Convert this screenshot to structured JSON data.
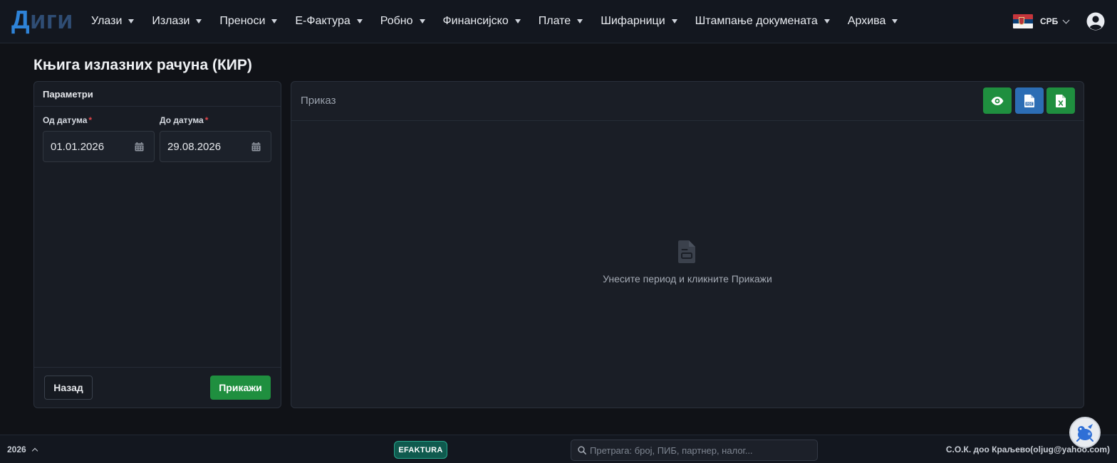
{
  "app": {
    "logo_part1": "Д",
    "logo_part2": "иги"
  },
  "nav": {
    "items": [
      {
        "label": "Улази"
      },
      {
        "label": "Излази"
      },
      {
        "label": "Преноси"
      },
      {
        "label": "Е-Фактура"
      },
      {
        "label": "Робно"
      },
      {
        "label": "Финансијско"
      },
      {
        "label": "Плате"
      },
      {
        "label": "Шифарници"
      },
      {
        "label": "Штампање докумената"
      },
      {
        "label": "Архива"
      }
    ],
    "language": "СРБ",
    "icons": {
      "dropdown": "caret-down-icon",
      "flag": "serbia-flag-icon",
      "user": "user-circle-icon"
    }
  },
  "page": {
    "title": "Књига излазних рачуна (КИР)"
  },
  "params": {
    "header": "Параметри",
    "from_label": "Од датума",
    "to_label": "До датума",
    "required_mark": "*",
    "from_value": "01.01.2026",
    "to_value": "29.08.2026",
    "back_label": "Назад",
    "show_label": "Прикажи"
  },
  "preview": {
    "title": "Приказ",
    "empty_text": "Унесите период и кликните Прикажи",
    "actions": [
      "eye-icon",
      "pdf-icon",
      "excel-icon"
    ]
  },
  "footer": {
    "year": "2026",
    "efaktura": "EFAKTURA",
    "search_placeholder": "Претрага: број, ПИБ, партнер, налог...",
    "company": "С.О.К. доо Краљево(oljug@yahoo.com)"
  },
  "colors": {
    "accent_green": "#1f8f3f",
    "accent_blue": "#2c6db4",
    "logo_blue": "#2e83d8",
    "efaktura_teal": "#0f5a4e",
    "required_red": "#e0454a"
  }
}
